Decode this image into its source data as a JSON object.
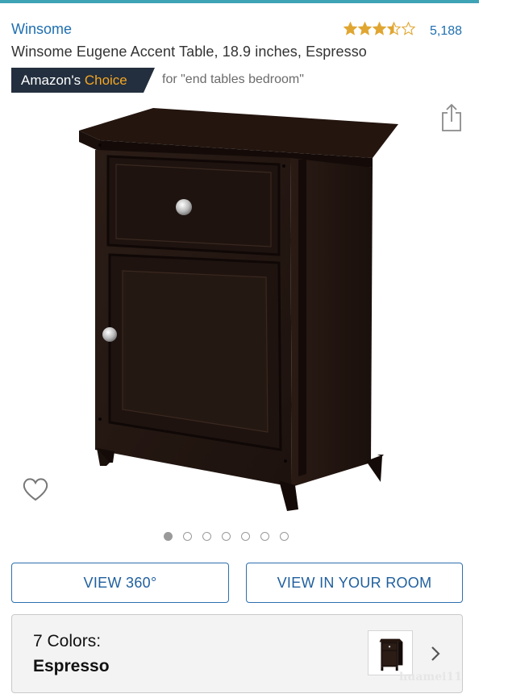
{
  "product": {
    "brand": "Winsome",
    "title": "Winsome Eugene Accent Table, 18.9 inches, Espresso",
    "rating": 3.5,
    "rating_max": 5,
    "rating_count": "5,188"
  },
  "badge": {
    "prefix": "Amazon's ",
    "highlight": "Choice",
    "for_text": "for \"end tables bedroom\""
  },
  "gallery": {
    "image_name": "espresso end table",
    "dots_total": 7,
    "active_index": 0
  },
  "buttons": {
    "view_360": "VIEW 360°",
    "view_in_room": "VIEW IN YOUR ROOM"
  },
  "colors": {
    "label": "7 Colors:",
    "selected": "Espresso"
  },
  "watermark": "huamei11",
  "icons": {
    "share": "share-icon",
    "wishlist": "heart-icon",
    "chevron": "chevron-right-icon",
    "star": "star-icon"
  },
  "theme": {
    "accent": "#3fa3b6",
    "link": "#1f6fb0",
    "badge_bg": "#232f3e",
    "badge_highlight": "#f5a623",
    "star": "#e0a631"
  }
}
